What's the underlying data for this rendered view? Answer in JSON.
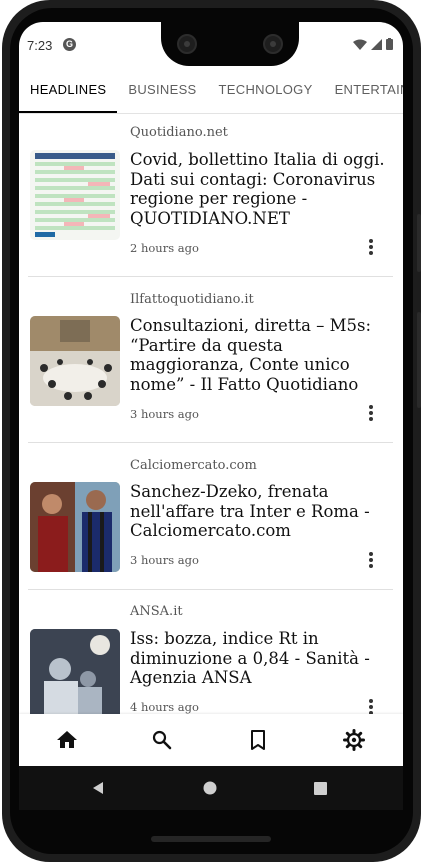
{
  "status_bar": {
    "time": "7:23",
    "app_icon": "G"
  },
  "tabs": [
    {
      "label": "HEADLINES",
      "active": true
    },
    {
      "label": "BUSINESS",
      "active": false
    },
    {
      "label": "TECHNOLOGY",
      "active": false
    },
    {
      "label": "ENTERTAINMENT",
      "active": false
    }
  ],
  "articles": [
    {
      "source": "Quotidiano.net",
      "title": "Covid, bollettino Italia di oggi. Dati sui contagi: Coronavirus regione per regione - QUOTIDIANO.NET",
      "time": "2 hours ago",
      "thumb": "table-image"
    },
    {
      "source": "Ilfattoquotidiano.it",
      "title": "Consultazioni, diretta – M5s: “Partire da questa maggioranza, Conte unico nome” - Il Fatto Quotidiano",
      "time": "3 hours ago",
      "thumb": "meeting-room-image"
    },
    {
      "source": "Calciomercato.com",
      "title": "Sanchez-Dzeko, frenata nell'affare tra Inter e Roma - Calciomercato.com",
      "time": "3 hours ago",
      "thumb": "football-players-image"
    },
    {
      "source": "ANSA.it",
      "title": "Iss: bozza, indice Rt in diminuzione a 0,84 - Sanità - Agenzia ANSA",
      "time": "4 hours ago",
      "thumb": "lab-workers-image"
    }
  ],
  "bottom_nav": [
    "home-icon",
    "search-icon",
    "bookmark-icon",
    "gear-icon"
  ],
  "system_nav": [
    "back-icon",
    "home-circle-icon",
    "recents-icon"
  ],
  "colors": {
    "accent": "#000000",
    "tab_inactive": "#5f5f5f"
  }
}
